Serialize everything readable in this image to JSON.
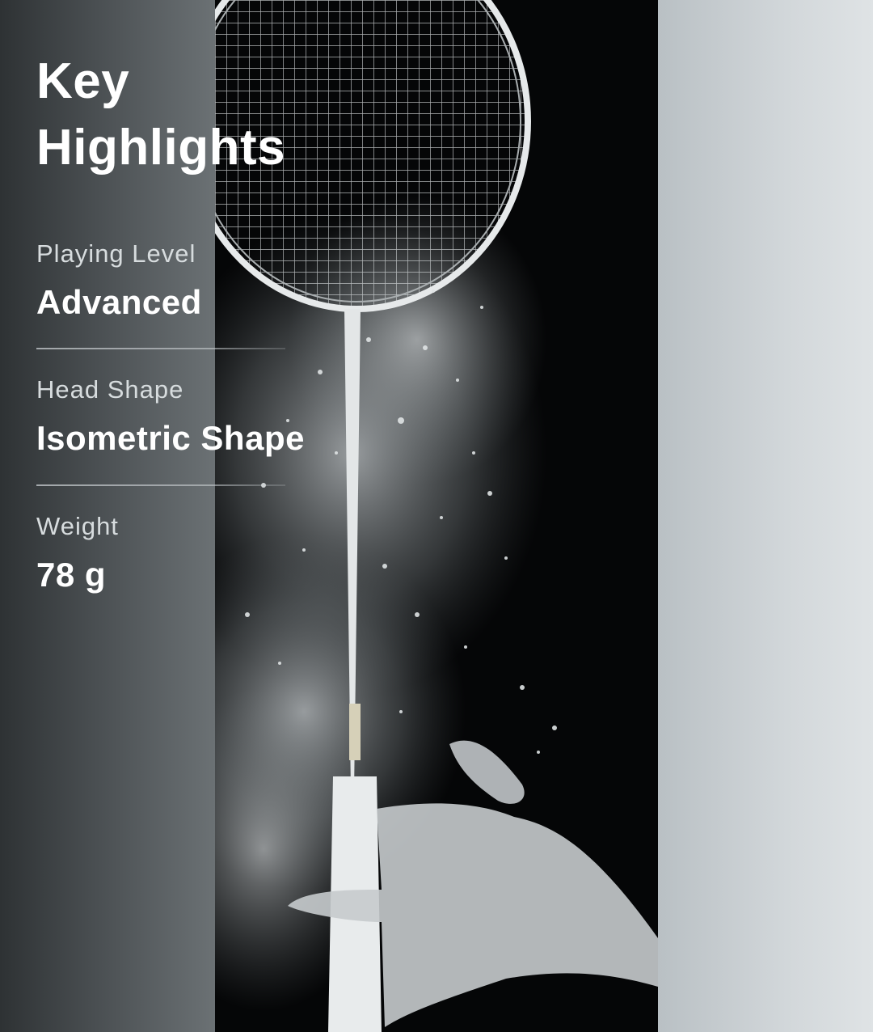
{
  "header": {
    "title_line1": "Key",
    "title_line2": "Highlights"
  },
  "specs": [
    {
      "label": "Playing Level",
      "value": "Advanced"
    },
    {
      "label": "Head Shape",
      "value": "Isometric Shape"
    },
    {
      "label": "Weight",
      "value": "78 g"
    }
  ],
  "colors": {
    "background_dark": "#2e3234",
    "photo_background": "#050607",
    "right_panel": "#d2d7da",
    "text_primary": "#ffffff",
    "text_label": "#d7dcde"
  },
  "image": {
    "icon": "badminton-racket-chalk-photo-icon"
  }
}
